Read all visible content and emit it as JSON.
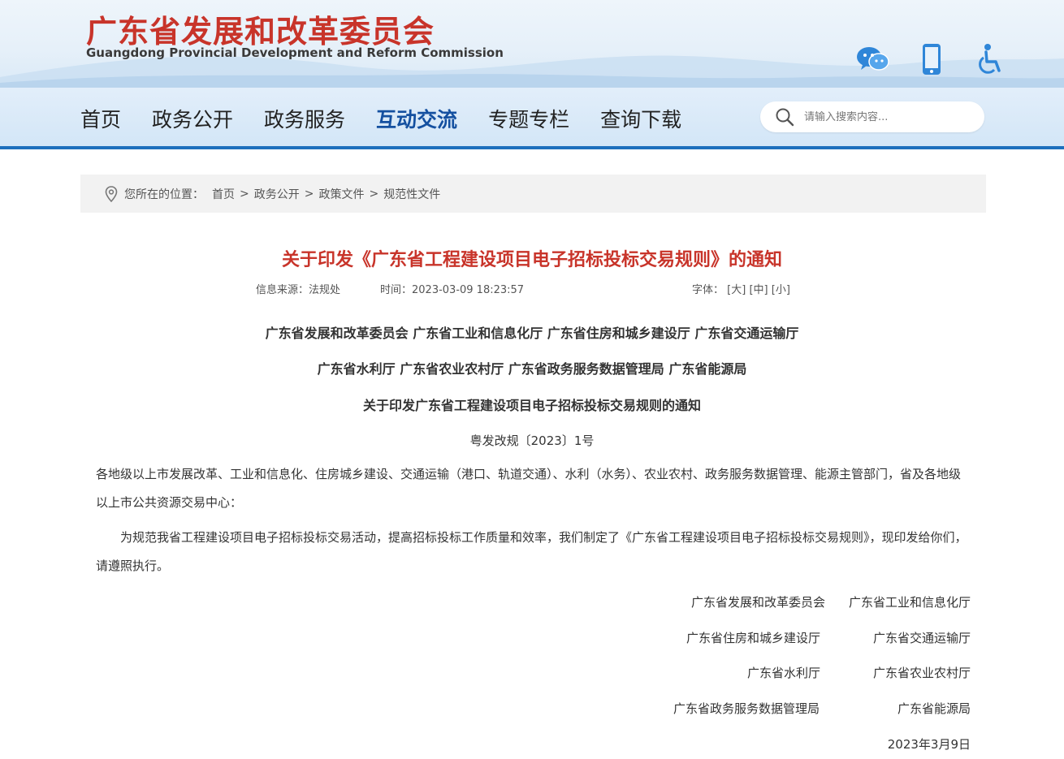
{
  "header": {
    "logo_cn": "广东省发展和改革委员会",
    "logo_en": "Guangdong Provincial Development and Reform Commission",
    "icons": [
      "wechat-icon",
      "mobile-icon",
      "accessibility-icon"
    ],
    "brand_color": "#c8342a",
    "accent_color": "#1d6fbd"
  },
  "nav": {
    "items": [
      "首页",
      "政务公开",
      "政务服务",
      "互动交流",
      "专题专栏",
      "查询下载"
    ],
    "active": "互动交流",
    "search_placeholder": "请输入搜索内容..."
  },
  "breadcrumb": {
    "label": "您所在的位置：",
    "items": [
      "首页",
      "政务公开",
      "政策文件",
      "规范性文件"
    ],
    "separator": ">"
  },
  "article": {
    "title": "关于印发《广东省工程建设项目电子招标投标交易规则》的通知",
    "source": "信息来源：法规处",
    "time": "时间：2023-03-09 18:23:57",
    "font_label": "字体：",
    "font_options": [
      "[大]",
      "[中]",
      "[小]"
    ],
    "issuers_line1": "广东省发展和改革委员会 广东省工业和信息化厅 广东省住房和城乡建设厅 广东省交通运输厅",
    "issuers_line2": "广东省水利厅 广东省农业农村厅  广东省政务服务数据管理局 广东省能源局",
    "doc_title": "关于印发广东省工程建设项目电子招标投标交易规则的通知",
    "doc_number": "粤发改规〔2023〕1号",
    "para1": "各地级以上市发展改革、工业和信息化、住房城乡建设、交通运输（港口、轨道交通）、水利（水务）、农业农村、政务服务数据管理、能源主管部门，省及各地级以上市公共资源交易中心：",
    "para2": "为规范我省工程建设项目电子招标投标交易活动，提高招标投标工作质量和效率，我们制定了《广东省工程建设项目电子招标投标交易规则》，现印发给你们，请遵照执行。",
    "signatures": [
      [
        "广东省发展和改革委员会",
        "广东省工业和信息化厅"
      ],
      [
        "广东省住房和城乡建设厅",
        "广东省交通运输厅"
      ],
      [
        "广东省水利厅",
        "广东省农业农村厅"
      ],
      [
        "广东省政务服务数据管理局",
        "广东省能源局"
      ]
    ],
    "date": "2023年3月9日"
  }
}
